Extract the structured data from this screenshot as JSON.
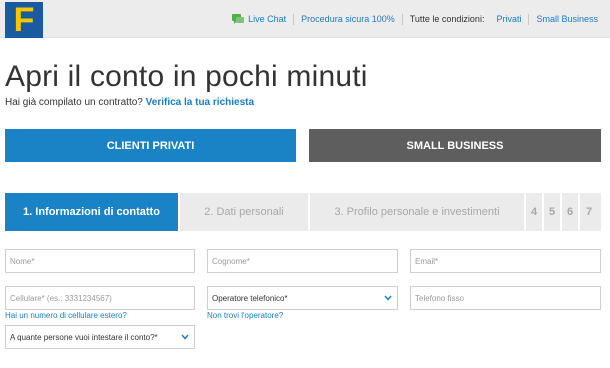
{
  "header": {
    "logo_letter": "F",
    "nav": {
      "live_chat": "Live Chat",
      "secure": "Procedura sicura 100%",
      "conditions_label": "Tutte le condizioni:",
      "privati": "Privati",
      "small_business": "Small Business"
    }
  },
  "page": {
    "title": "Apri il conto in pochi minuti",
    "subtitle_prefix": "Hai già compilato un contratto?",
    "subtitle_link": "Verifica la tua richiesta"
  },
  "segments": {
    "private": "CLIENTI PRIVATI",
    "business": "SMALL BUSINESS"
  },
  "steps": [
    {
      "label": "1. Informazioni di contatto"
    },
    {
      "label": "2. Dati personali"
    },
    {
      "label": "3. Profilo personale e investimenti"
    },
    {
      "label": "4"
    },
    {
      "label": "5"
    },
    {
      "label": "6"
    },
    {
      "label": "7"
    }
  ],
  "form": {
    "nome": "Nome*",
    "cognome": "Cognome*",
    "email": "Email*",
    "cellulare": "Cellulare* (es.: 3331234567)",
    "operatore": "Operatore telefonico*",
    "telefono_fisso": "Telefono fisso",
    "cellulare_hint": "Hai un numero di cellulare estero?",
    "operatore_hint": "Non trovi l'operatore?",
    "intestatari": "A quante persone vuoi intestare il conto?*"
  },
  "colors": {
    "brand_blue": "#1a83c6",
    "logo_blue": "#1a5aa0",
    "logo_yellow": "#f7c600",
    "business_gray": "#5e5e5e",
    "link_blue": "#1b7bc4",
    "chat_green": "#4caf50"
  }
}
